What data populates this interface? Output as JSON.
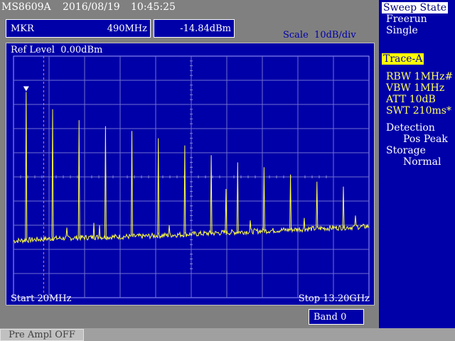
{
  "header": {
    "model": "MS8609A",
    "date": "2016/08/19",
    "time": "10:45:25"
  },
  "marker": {
    "label": "MKR",
    "frequency": "490MHz",
    "level": "-14.84dBm"
  },
  "scale_text": "Scale  10dB/div",
  "screen": {
    "ref_level": "Ref Level  0.00dBm",
    "start": "Start 20MHz",
    "stop": "Stop 13.20GHz"
  },
  "band": "Band 0",
  "sidebar": {
    "sweep_state_title": "Sweep State",
    "sweep_freerun": "Freerun",
    "sweep_single": "Single",
    "trace_title": "Trace-A",
    "rbw": "RBW 1MHz#",
    "vbw": "VBW 1MHz",
    "att": "ATT 10dB",
    "swt": "SWT 210ms*",
    "detection_title": "Detection",
    "detection_value": "Pos Peak",
    "storage_title": "Storage",
    "storage_value": "Normal"
  },
  "pre_ampl": "Pre Ampl OFF",
  "chart_data": {
    "type": "line",
    "xlim": [
      20,
      13200
    ],
    "x_unit": "MHz",
    "ylim": [
      -100,
      0
    ],
    "y_unit": "dBm",
    "y_div": 10,
    "grid": true,
    "marker_freq": 490,
    "marker_level": -14.84,
    "noise_floor": [
      {
        "f": 20,
        "dbm": -76.5
      },
      {
        "f": 1500,
        "dbm": -75.5
      },
      {
        "f": 3000,
        "dbm": -75
      },
      {
        "f": 5000,
        "dbm": -74.5
      },
      {
        "f": 7000,
        "dbm": -73.5
      },
      {
        "f": 9000,
        "dbm": -72.5
      },
      {
        "f": 11000,
        "dbm": -71.5
      },
      {
        "f": 13200,
        "dbm": -70.5
      }
    ],
    "peaks": [
      {
        "f": 490,
        "dbm": -14.84
      },
      {
        "f": 1470,
        "dbm": -22
      },
      {
        "f": 2450,
        "dbm": -26.5
      },
      {
        "f": 3430,
        "dbm": -29
      },
      {
        "f": 4410,
        "dbm": -31
      },
      {
        "f": 5390,
        "dbm": -34
      },
      {
        "f": 6370,
        "dbm": -37
      },
      {
        "f": 7350,
        "dbm": -41
      },
      {
        "f": 7900,
        "dbm": -55
      },
      {
        "f": 8330,
        "dbm": -44
      },
      {
        "f": 9310,
        "dbm": -46
      },
      {
        "f": 10290,
        "dbm": -49
      },
      {
        "f": 11270,
        "dbm": -52
      },
      {
        "f": 12250,
        "dbm": -54
      }
    ],
    "small_peaks": [
      {
        "f": 2000,
        "dbm": -71
      },
      {
        "f": 3000,
        "dbm": -69
      },
      {
        "f": 3200,
        "dbm": -70
      },
      {
        "f": 5800,
        "dbm": -70
      },
      {
        "f": 8800,
        "dbm": -68
      },
      {
        "f": 10800,
        "dbm": -67
      },
      {
        "f": 12700,
        "dbm": -66
      }
    ]
  }
}
